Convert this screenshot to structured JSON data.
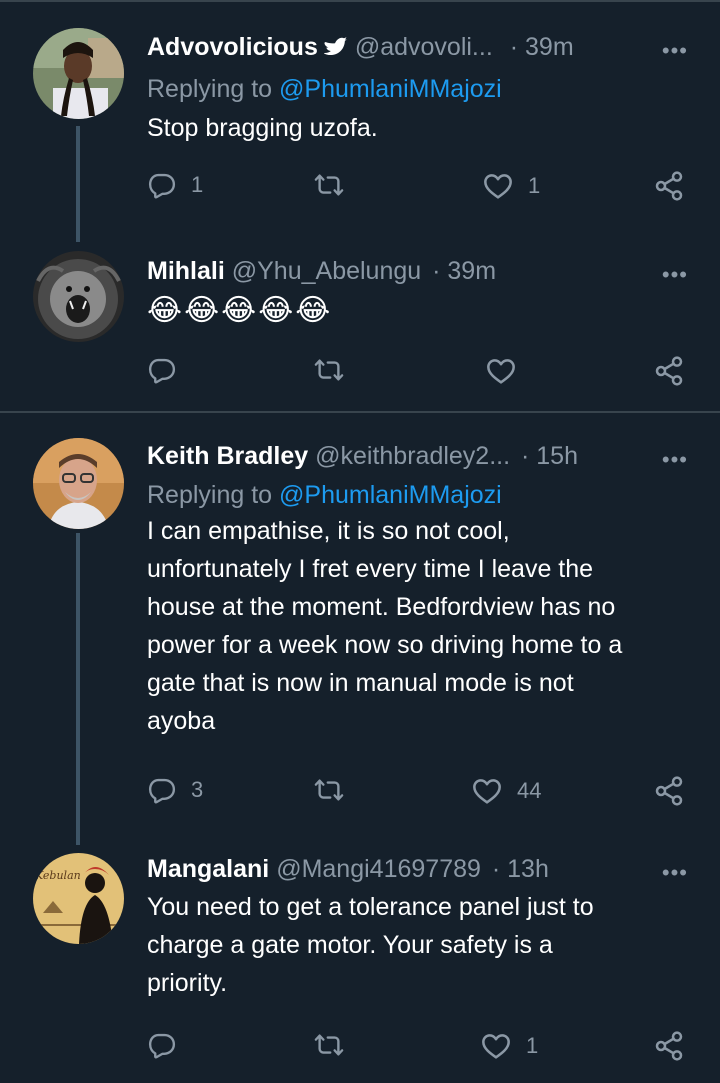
{
  "tweets": [
    {
      "name": "Advovolicious",
      "verified": true,
      "handle": "@advovoli...",
      "time": "· 39m",
      "replying_label": "Replying to",
      "replying_to": "@PhumlaniMMajozi",
      "text": "Stop bragging uzofa.",
      "replies": "1",
      "retweets": "",
      "likes": "1",
      "avatar": "woman-with-braids-avatar"
    },
    {
      "name": "Mihlali",
      "handle": "@Yhu_Abelungu",
      "time": "· 39m",
      "emojis": [
        "😂",
        "😂",
        "😂",
        "😂",
        "😂"
      ],
      "replies": "",
      "retweets": "",
      "likes": "",
      "avatar": "roaring-lion-avatar"
    },
    {
      "name": "Keith Bradley",
      "handle": "@keithbradley2...",
      "time": "· 15h",
      "replying_label": "Replying to",
      "replying_to": "@PhumlaniMMajozi",
      "text_lines": [
        "I can empathise, it is so not cool,",
        "unfortunately I fret every time I leave the",
        "house at the moment. Bedfordview has no",
        "power for a week now so driving home to a",
        "gate that is now in manual mode is not",
        "ayoba"
      ],
      "replies": "3",
      "retweets": "",
      "likes": "44",
      "avatar": "man-with-glasses-avatar"
    },
    {
      "name": "Mangalani",
      "handle": "@Mangi41697789",
      "time": "· 13h",
      "text_lines": [
        "You need to get a tolerance panel just to",
        "charge a gate motor. Your safety is a",
        "priority."
      ],
      "replies": "",
      "retweets": "",
      "likes": "1",
      "avatar": "kebulane-art-avatar"
    }
  ],
  "colors": {
    "background": "#15202b",
    "secondary_text": "#8b98a5",
    "link": "#1d9bf0",
    "divider": "#38444d",
    "verified": "#ffffff"
  }
}
